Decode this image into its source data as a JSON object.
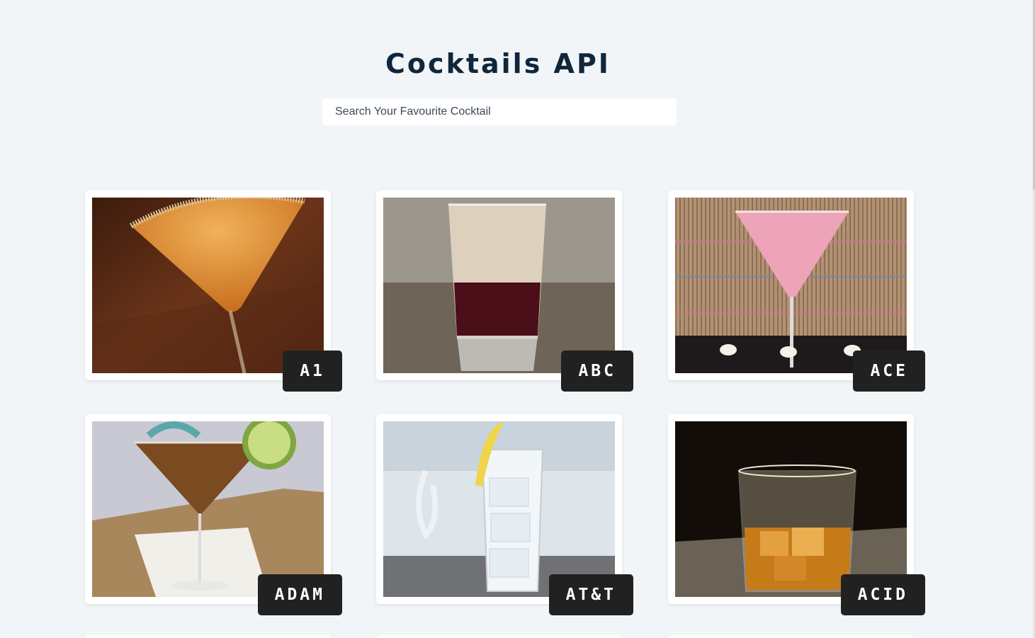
{
  "header": {
    "title": "Cocktails API"
  },
  "search": {
    "placeholder": "Search Your Favourite Cocktail",
    "value": ""
  },
  "cocktails": [
    {
      "name": "A1",
      "image": "orange-martini-glass"
    },
    {
      "name": "ABC",
      "image": "layered-shot-glass"
    },
    {
      "name": "ACE",
      "image": "pink-martini-glass"
    },
    {
      "name": "ADAM",
      "image": "amber-martini-with-lime"
    },
    {
      "name": "AT&T",
      "image": "highball-with-lemon"
    },
    {
      "name": "ACID",
      "image": "whiskey-on-rocks"
    }
  ],
  "colors": {
    "background": "#f1f5f8",
    "title": "#10263b",
    "label_background": "#212121",
    "label_text": "#ffffff",
    "card": "#ffffff"
  }
}
